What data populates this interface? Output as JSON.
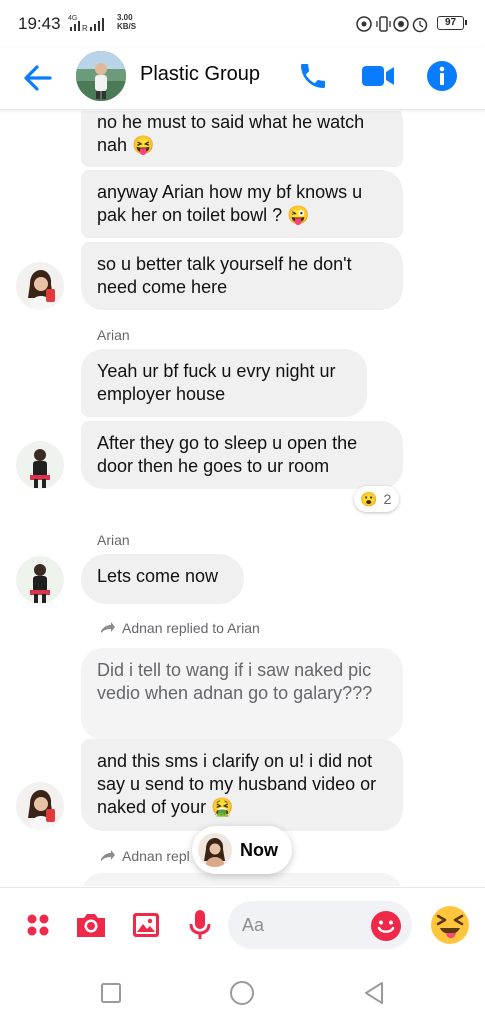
{
  "status_bar": {
    "time": "19:43",
    "network": "4G",
    "speed_value": "3.00",
    "speed_unit": "KB/S",
    "battery": "97"
  },
  "header": {
    "title": "Plastic Group",
    "icons": [
      "back-arrow-icon",
      "phone-icon",
      "video-camera-icon",
      "info-icon"
    ],
    "accent_color": "#0a7cff"
  },
  "messages": [
    {
      "id": "m1",
      "sender": "",
      "text": "no he must to said what he watch nah 😝"
    },
    {
      "id": "m2",
      "sender": "",
      "text": "anyway Arian how my bf knows u pak her on toilet bowl ? 😜"
    },
    {
      "id": "m3",
      "sender": "",
      "text": "so u better talk yourself he don't need come here"
    },
    {
      "id": "m4",
      "sender": "Arian",
      "text": "Yeah ur bf fuck u evry night ur employer house"
    },
    {
      "id": "m5",
      "sender": "",
      "text": "After  they go to sleep  u open the door then he goes to ur room",
      "reaction": {
        "emoji": "😮",
        "count": "2"
      }
    },
    {
      "id": "m6",
      "sender": "Arian",
      "text": "Lets come now"
    },
    {
      "id": "m7",
      "reply_note": "Adnan replied to Arian",
      "text": "Did i tell to wang if i saw naked pic vedio when adnan go to galary???",
      "quoted": true
    },
    {
      "id": "m8",
      "sender": "",
      "text": "and this sms i clarify on u! i did not say u send to my husband video or naked of your 🤮"
    },
    {
      "id": "m9",
      "reply_note": "Adnan repl"
    }
  ],
  "now_pill": {
    "label": "Now"
  },
  "composer": {
    "placeholder": "Aa",
    "icons": [
      "more-dots-icon",
      "camera-icon",
      "gallery-icon",
      "microphone-icon",
      "emoji-icon",
      "squint-tongue-emoji-icon"
    ],
    "accent_color": "#f02849"
  },
  "nav": {
    "icons": [
      "recent-apps-icon",
      "home-icon",
      "back-icon"
    ]
  }
}
